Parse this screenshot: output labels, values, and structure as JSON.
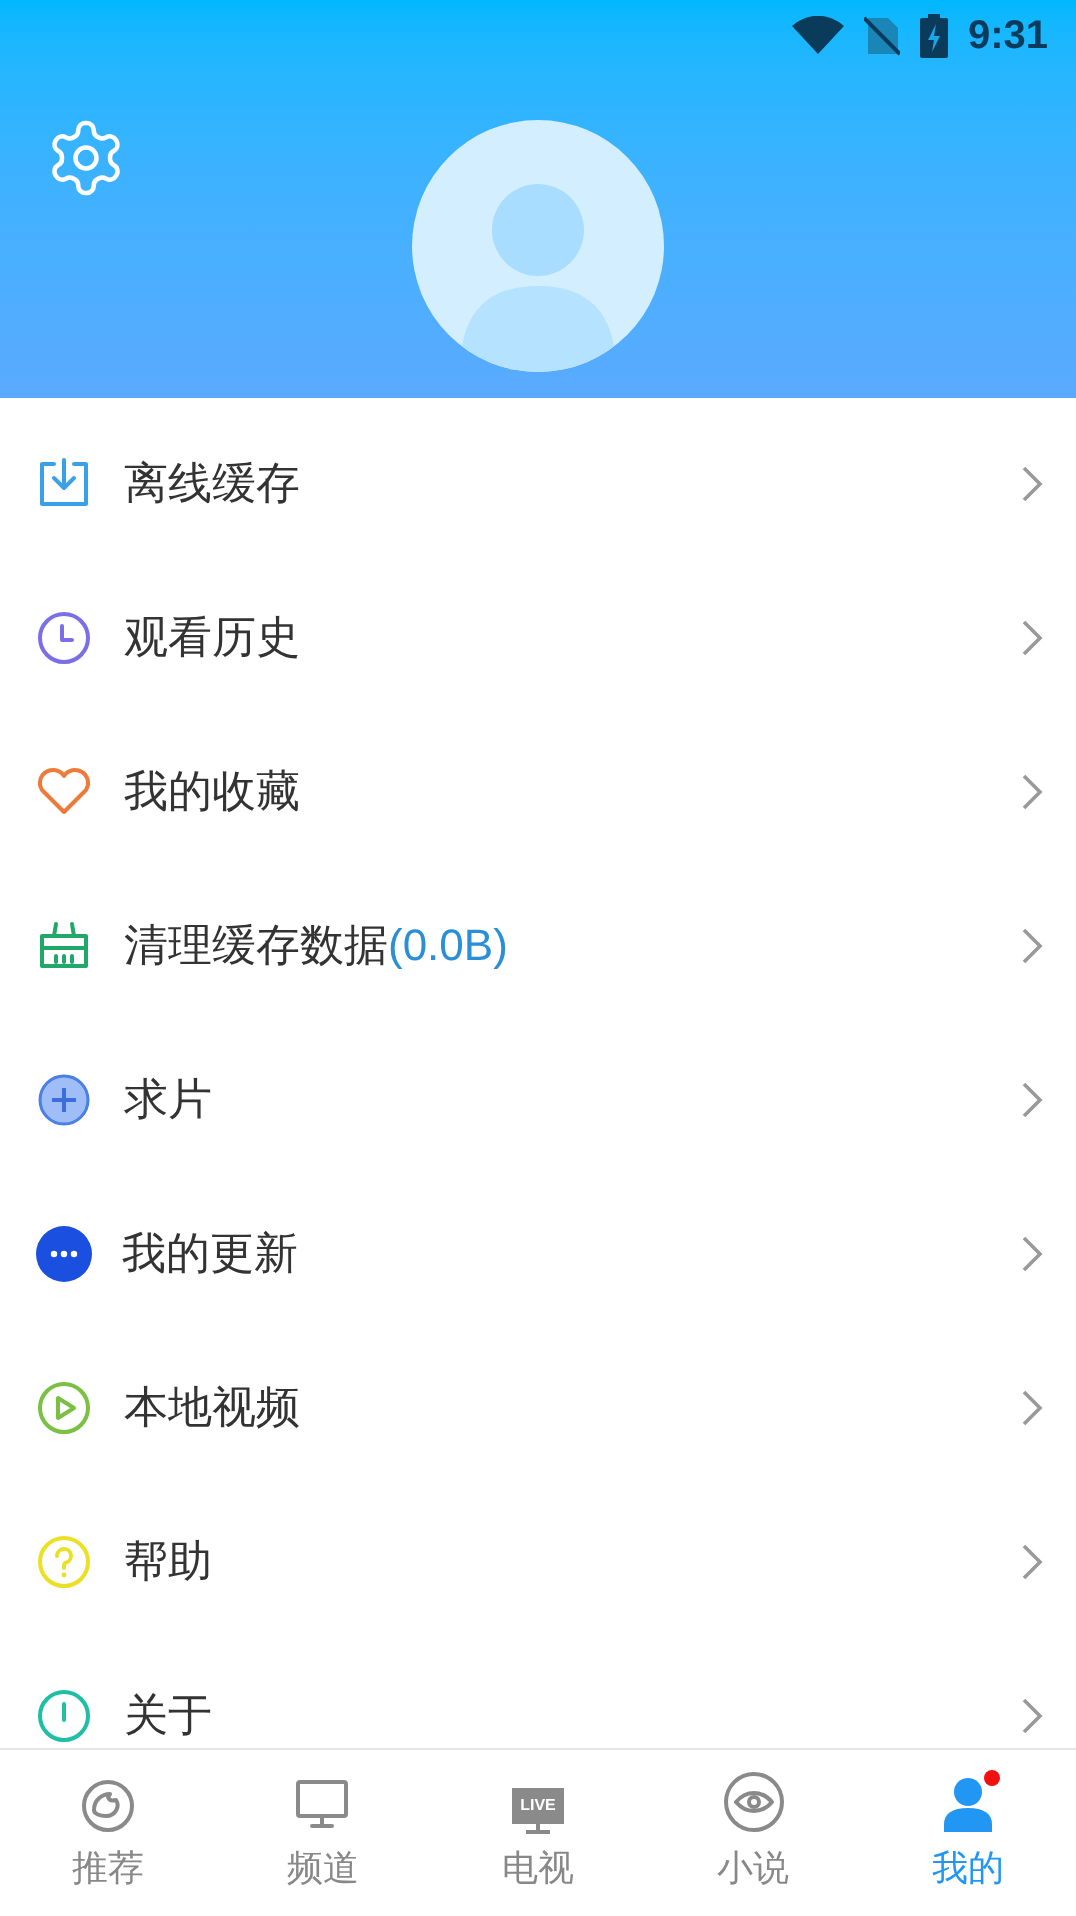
{
  "status_bar": {
    "time": "9:31"
  },
  "menu": [
    {
      "label": "离线缓存"
    },
    {
      "label": "观看历史"
    },
    {
      "label": "我的收藏"
    },
    {
      "label": "清理缓存数据",
      "extra": "(0.0B)"
    },
    {
      "label": "求片"
    },
    {
      "label": "我的更新"
    },
    {
      "label": "本地视频"
    },
    {
      "label": "帮助"
    },
    {
      "label": "关于"
    }
  ],
  "tabs": [
    {
      "label": "推荐",
      "selected": false,
      "dot": false
    },
    {
      "label": "频道",
      "selected": false,
      "dot": false
    },
    {
      "label": "电视",
      "selected": false,
      "dot": false,
      "screen_text": "LIVE"
    },
    {
      "label": "小说",
      "selected": false,
      "dot": false
    },
    {
      "label": "我的",
      "selected": true,
      "dot": true
    }
  ]
}
